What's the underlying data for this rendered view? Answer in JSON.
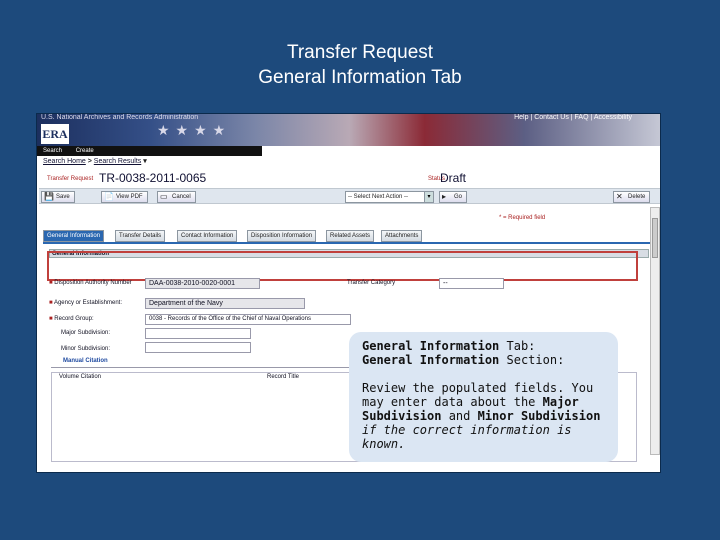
{
  "slide": {
    "title_line1": "Transfer Request",
    "title_line2": "General Information Tab"
  },
  "screenshot": {
    "header": {
      "top_left_text": "U.S. National Archives and Records Administration",
      "top_right_text": "Help | Contact Us | FAQ | Accessibility",
      "logo_text": "ERA"
    },
    "nav": {
      "search": "Search",
      "create": "Create"
    },
    "breadcrumb": {
      "home": "Search Home",
      "sep": ">",
      "results": "Search Results",
      "arrow": "▾"
    },
    "request": {
      "label": "Transfer Request",
      "id": "TR-0038-2011-0065",
      "status_label": "Status",
      "status_value": "Draft"
    },
    "toolbar": {
      "save": "Save",
      "view_pdf": "View PDF",
      "cancel": "Cancel",
      "next_action": "-- Select Next Action --",
      "go": "Go",
      "delete": "Delete"
    },
    "required_note": "* = Required field",
    "tabs": [
      "General Information",
      "Transfer Details",
      "Contact Information",
      "Disposition Information",
      "Related Assets",
      "Attachments"
    ],
    "section_title": "General Information",
    "fields": {
      "disposition_label": "Disposition Authority Number",
      "disposition_value": "DAA-0038-2010-0020-0001",
      "category_label": "Transfer Category",
      "category_value": "--",
      "agency_label": "Agency or Establishment:",
      "agency_value": "Department of the Navy",
      "record_group_label": "Record Group:",
      "record_group_value": "0038 - Records of the Office of the Chief of Naval Operations",
      "major_label": "Major Subdivision:",
      "minor_label": "Minor Subdivision:"
    },
    "manual_citation": "Manual Citation",
    "columns": {
      "c1": "Volume Citation",
      "c2": "Record Title"
    }
  },
  "tip": {
    "line1_bold": "General Information",
    "line1_rest": " Tab:",
    "line2_bold": "General Information",
    "line2_rest": " Section:",
    "p_start": "Review the populated fields. You may enter data about the ",
    "major": "Major Subdivision",
    "and": " and ",
    "minor": "Minor Subdivision",
    "italic_tail": " if the correct information is known."
  }
}
